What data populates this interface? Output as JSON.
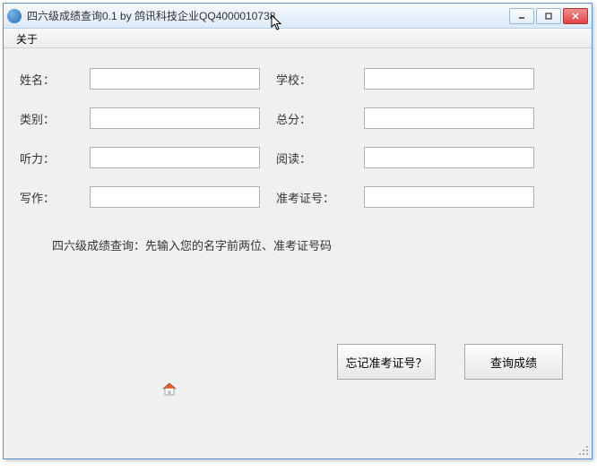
{
  "window": {
    "title": "四六级成绩查询0.1 by 鸽讯科技企业QQ4000010738"
  },
  "menu": {
    "about": "关于"
  },
  "labels": {
    "name": "姓名：",
    "school": "学校：",
    "category": "类别：",
    "total": "总分：",
    "listening": "听力：",
    "reading": "阅读：",
    "writing": "写作：",
    "ticket": "准考证号："
  },
  "fields": {
    "name": "",
    "school": "",
    "category": "",
    "total": "",
    "listening": "",
    "reading": "",
    "writing": "",
    "ticket": ""
  },
  "hint": "四六级成绩查询：先输入您的名字前两位、准考证号码",
  "buttons": {
    "forgot": "忘记准考证号？",
    "query": "查询成绩"
  }
}
